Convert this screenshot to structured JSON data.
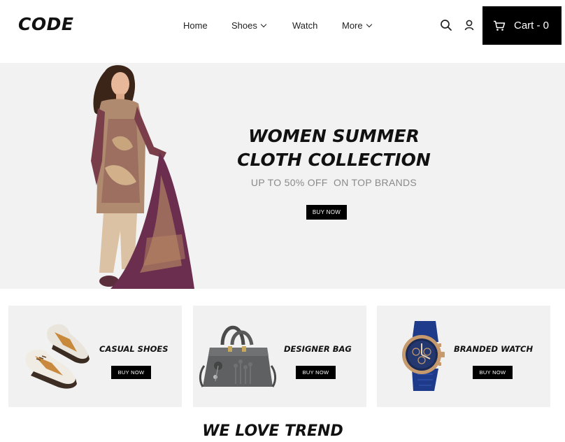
{
  "header": {
    "logo": "CODE",
    "nav": {
      "home": "Home",
      "shoes": "Shoes",
      "watch": "Watch",
      "more": "More"
    },
    "icons": [
      "search-icon",
      "user-icon",
      "cart-icon",
      "chevron-down-icon"
    ],
    "cart_label": "Cart - 0"
  },
  "hero": {
    "title_line1": "WOMEN SUMMER",
    "title_line2": "CLOTH COLLECTION",
    "subtitle": "UP TO 50% OFF  ON TOP BRANDS",
    "button": "BUY NOW"
  },
  "categories": [
    {
      "title": "CASUAL SHOES",
      "button": "BUY NOW"
    },
    {
      "title": "DESIGNER BAG",
      "button": "BUY NOW"
    },
    {
      "title": "BRANDED WATCH",
      "button": "BUY NOW"
    }
  ],
  "section_title": "WE LOVE TREND",
  "colors": {
    "accent": "#000000",
    "hero_bg": "#f2f2f2",
    "card_bg": "#f1f1f1",
    "subtitle_gray": "#8a8a8a"
  }
}
